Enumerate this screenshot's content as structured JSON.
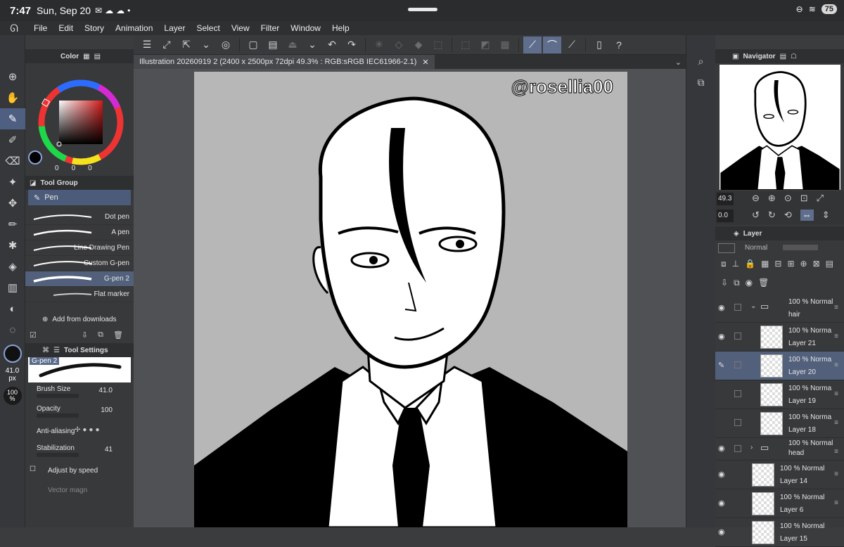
{
  "status": {
    "time": "7:47",
    "date": "Sun, Sep 20",
    "battery": "75"
  },
  "menu": [
    "File",
    "Edit",
    "Story",
    "Animation",
    "Layer",
    "Select",
    "View",
    "Filter",
    "Window",
    "Help"
  ],
  "color_panel": {
    "title": "Color",
    "fields": [
      "0",
      "0",
      "0"
    ]
  },
  "tool_group": {
    "title": "Tool Group",
    "current": "Pen",
    "items": [
      "Dot pen",
      "A pen",
      "Line Drawing Pen",
      "Custom G-pen",
      "G-pen 2",
      "Flat marker"
    ],
    "selected_index": 4,
    "add": "Add from downloads"
  },
  "tool_settings": {
    "title": "Tool Settings",
    "preset": "G-pen 2",
    "brush_size_label": "Brush Size",
    "brush_size": "41.0",
    "opacity_label": "Opacity",
    "opacity": "100",
    "antialias_label": "Anti-aliasing",
    "stabilization_label": "Stabilization",
    "stabilization": "41",
    "adjust_label": "Adjust by speed",
    "vector_label": "Vector magn"
  },
  "left_strip": {
    "size": "41.0",
    "size_unit": "px",
    "opacity": "100",
    "opacity_unit": "%"
  },
  "canvas_tab": "Illustration 20260919 2 (2400 x 2500px 72dpi 49.3% : RGB:sRGB IEC61966-2.1)",
  "watermark": "@rosellia00",
  "navigator": {
    "title": "Navigator",
    "zoom": "49.3",
    "rotation": "0.0"
  },
  "layer_panel": {
    "title": "Layer",
    "blend": "Normal"
  },
  "layers": [
    {
      "type": "folder",
      "pct": "100 %",
      "blend": "Normal",
      "name": "hair",
      "expanded": true
    },
    {
      "type": "layer",
      "pct": "100 %",
      "blend": "Norma",
      "name": "Layer 21"
    },
    {
      "type": "layer",
      "pct": "100 %",
      "blend": "Norma",
      "name": "Layer 20",
      "selected": true
    },
    {
      "type": "layer",
      "pct": "100 %",
      "blend": "Norma",
      "name": "Layer 19"
    },
    {
      "type": "layer",
      "pct": "100 %",
      "blend": "Norma",
      "name": "Layer 18"
    },
    {
      "type": "folder",
      "pct": "100 %",
      "blend": "Normal",
      "name": "head",
      "expanded": false
    },
    {
      "type": "layer",
      "pct": "100 %",
      "blend": "Normal",
      "name": "Layer 14"
    },
    {
      "type": "layer",
      "pct": "100 %",
      "blend": "Normal",
      "name": "Layer 6"
    },
    {
      "type": "layer",
      "pct": "100 %",
      "blend": "Normal",
      "name": "Layer 15"
    }
  ]
}
